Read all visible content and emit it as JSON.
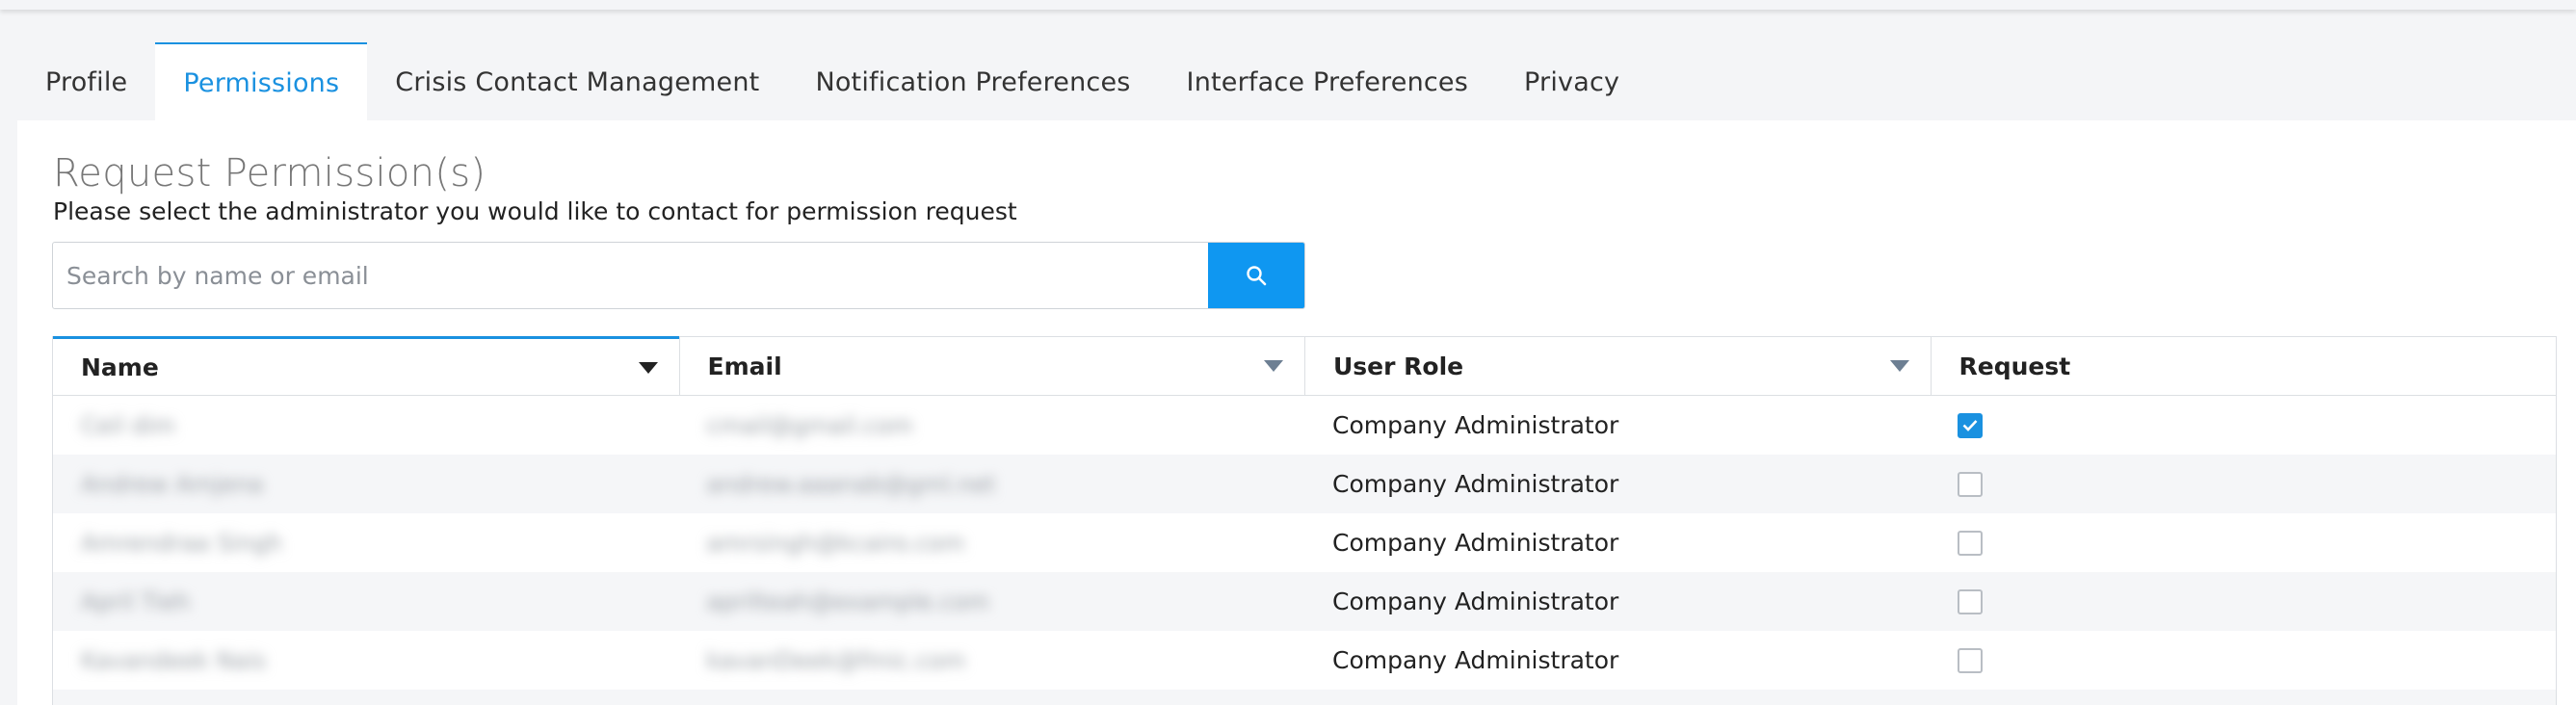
{
  "tabs": [
    {
      "label": "Profile",
      "active": false
    },
    {
      "label": "Permissions",
      "active": true
    },
    {
      "label": "Crisis Contact Management",
      "active": false
    },
    {
      "label": "Notification Preferences",
      "active": false
    },
    {
      "label": "Interface Preferences",
      "active": false
    },
    {
      "label": "Privacy",
      "active": false
    }
  ],
  "page": {
    "title": "Request Permission(s)",
    "subtitle": "Please select the administrator you would like to contact for permission request"
  },
  "search": {
    "placeholder": "Search by name or email",
    "value": "",
    "button_icon": "search-icon"
  },
  "table": {
    "columns": [
      "Name",
      "Email",
      "User Role",
      "Request"
    ],
    "rows": [
      {
        "name": "Ceil dim",
        "email": "cmail@gmail.com",
        "role": "Company Administrator",
        "requested": true
      },
      {
        "name": "Andrew Amjena",
        "email": "andrew.aaanab@gml.net",
        "role": "Company Administrator",
        "requested": false
      },
      {
        "name": "Amrendraa Singh",
        "email": "amrsingh@kcairo.com",
        "role": "Company Administrator",
        "requested": false
      },
      {
        "name": "April Tieh",
        "email": "aprilteah@example.com",
        "role": "Company Administrator",
        "requested": false
      },
      {
        "name": "Kavandeek Nais",
        "email": "kavanDeek@fmic.com",
        "role": "Company Administrator",
        "requested": false
      }
    ]
  },
  "colors": {
    "accent": "#1a91e0",
    "search_button": "#0f97f1",
    "page_bg": "#f4f5f7"
  }
}
